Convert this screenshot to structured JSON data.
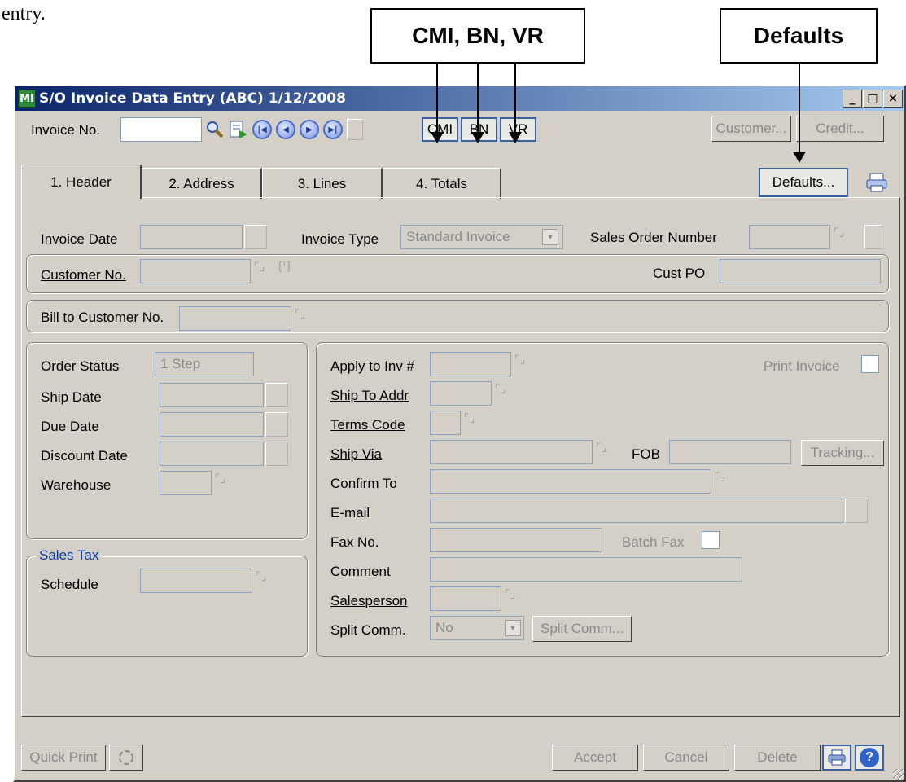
{
  "doc": {
    "text": "entry."
  },
  "callouts": {
    "cmi_bn_vr": "CMI, BN, VR",
    "defaults": "Defaults"
  },
  "window": {
    "title": "S/O Invoice Data Entry (ABC) 1/12/2008",
    "app_icon": "MI",
    "min": "_",
    "max": "□",
    "close": "×"
  },
  "toolbar": {
    "invoice_no_label": "Invoice No.",
    "invoice_no_value": "",
    "cmi": "CMI",
    "bn": "BN",
    "vr": "VR",
    "customer": "Customer...",
    "credit": "Credit..."
  },
  "tabs": [
    "1. Header",
    "2. Address",
    "3. Lines",
    "4. Totals"
  ],
  "defaults_button": "Defaults...",
  "header": {
    "invoice_date": "Invoice Date",
    "invoice_type": "Invoice Type",
    "invoice_type_value": "Standard Invoice",
    "sales_order_number": "Sales Order Number",
    "customer_no": "Customer No.",
    "cust_po": "Cust PO",
    "bill_to": "Bill to Customer No."
  },
  "left": {
    "order_status": "Order Status",
    "order_status_value": "1 Step",
    "ship_date": "Ship Date",
    "due_date": "Due Date",
    "discount_date": "Discount Date",
    "warehouse": "Warehouse",
    "sales_tax": "Sales Tax",
    "schedule": "Schedule"
  },
  "right": {
    "apply_to_inv": "Apply to Inv #",
    "print_invoice": "Print Invoice",
    "ship_to_addr": "Ship To Addr",
    "terms_code": "Terms Code",
    "ship_via": "Ship Via",
    "fob": "FOB",
    "tracking": "Tracking...",
    "confirm_to": "Confirm To",
    "email": "E-mail",
    "fax_no": "Fax No.",
    "batch_fax": "Batch Fax",
    "comment": "Comment",
    "salesperson": "Salesperson",
    "split_comm": "Split Comm.",
    "split_comm_value": "No",
    "split_comm_button": "Split Comm..."
  },
  "footer": {
    "quick_print": "Quick Print",
    "accept": "Accept",
    "cancel": "Cancel",
    "delete": "Delete",
    "help": "?"
  }
}
